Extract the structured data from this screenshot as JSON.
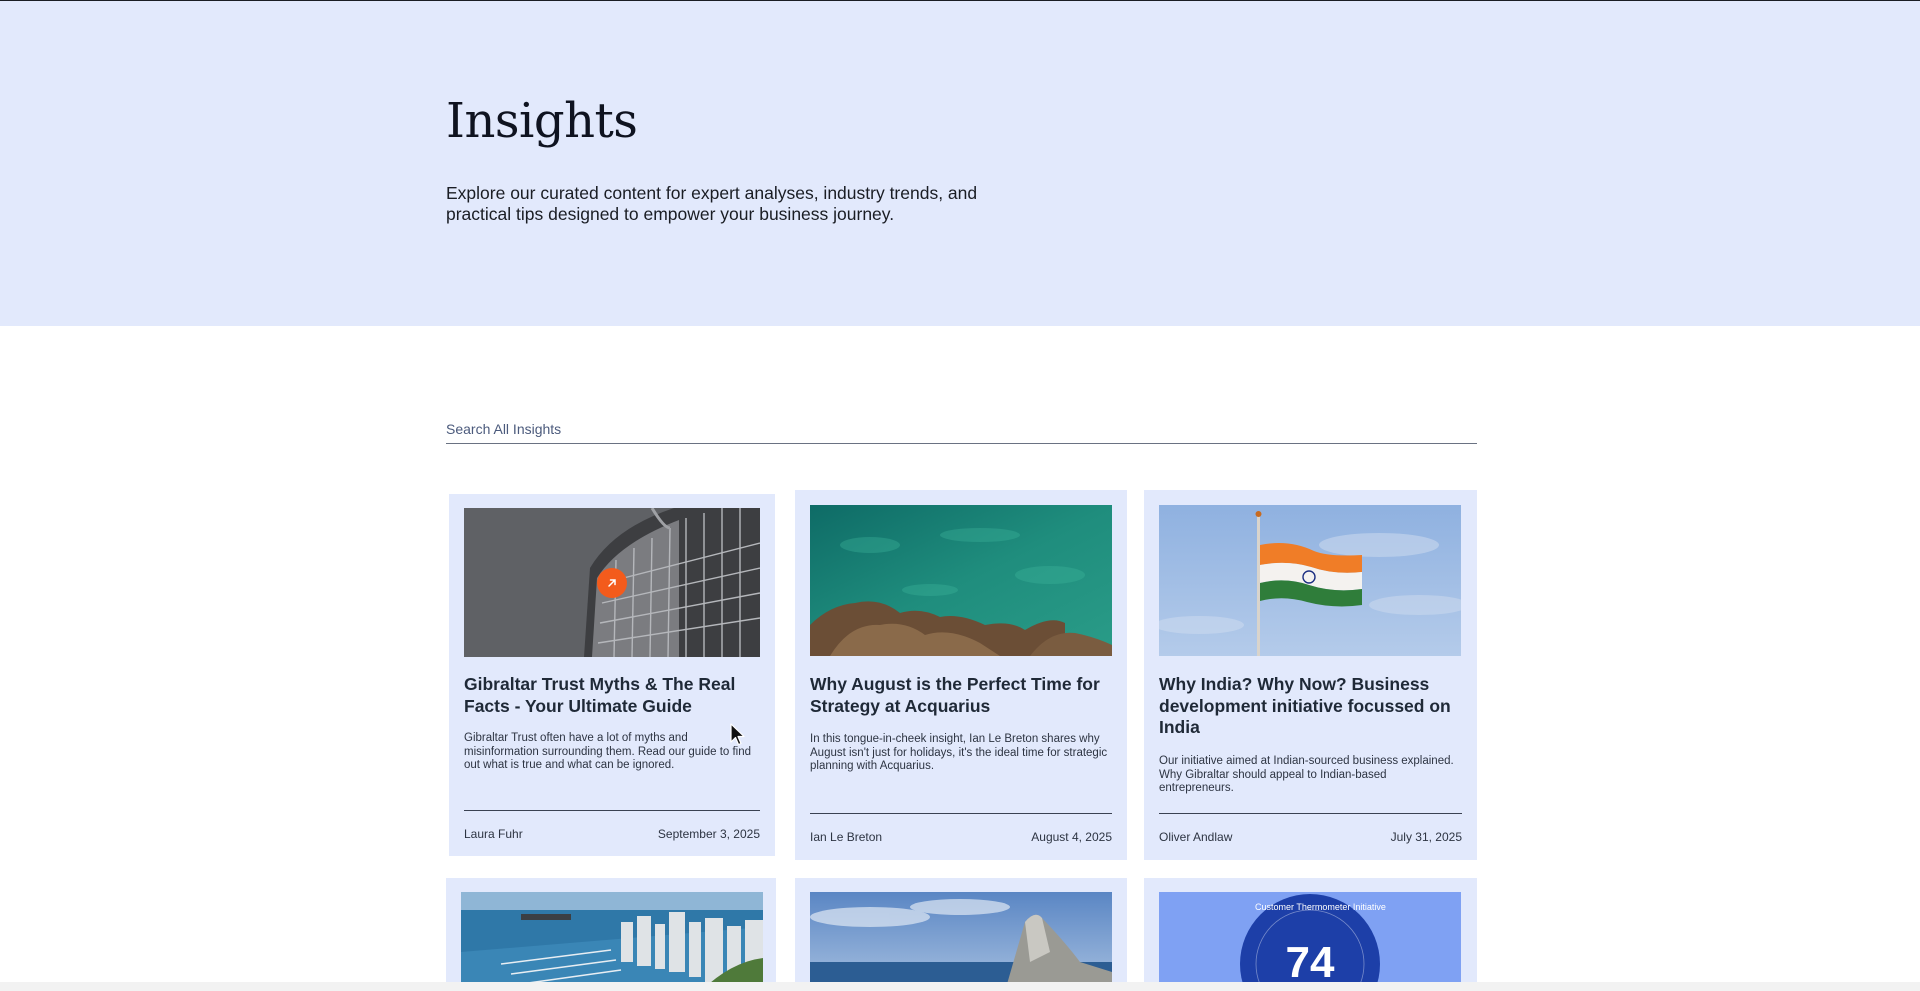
{
  "hero": {
    "title": "Insights",
    "subtitle": "Explore our curated content for expert analyses, industry trends, and practical tips designed to empower your business journey."
  },
  "search": {
    "placeholder": "Search All Insights"
  },
  "cards": [
    {
      "title": "Gibraltar Trust Myths & The Real Facts - Your Ultimate Guide",
      "description": "Gibraltar Trust often have a lot of myths and misinformation surrounding them. Read our guide to find out what is true and what can be ignored.",
      "author": "Laura Fuhr",
      "date": "September 3, 2025"
    },
    {
      "title": "Why August is the Perfect Time for Strategy at Acquarius",
      "description": "In this tongue-in-cheek insight, Ian Le Breton shares why August isn't just for holidays, it's the ideal time for strategic planning with Acquarius.",
      "author": "Ian Le Breton",
      "date": "August 4, 2025"
    },
    {
      "title": "Why India? Why Now? Business development initiative focussed on India",
      "description": "Our initiative aimed at Indian-sourced business explained. Why Gibraltar should appeal to Indian-based entrepreneurs.",
      "author": "Oliver Andlaw",
      "date": "July 31, 2025"
    }
  ],
  "badge": {
    "number": "74",
    "ring_text": "Customer Thermometer Initiative"
  },
  "colors": {
    "hero_bg": "#e2e9fc",
    "card_bg": "#e2e9fc",
    "accent": "#f35b1c",
    "badge_blue": "#1d3fa8"
  }
}
